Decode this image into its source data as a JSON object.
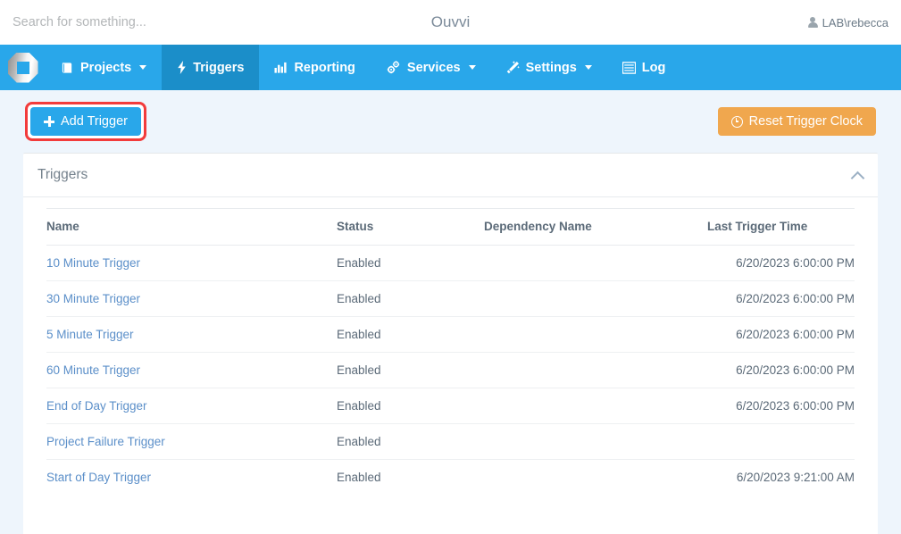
{
  "topbar": {
    "search_placeholder": "Search for something...",
    "search_value": "",
    "app_title": "Ouvvi",
    "user_name": "LAB\\rebecca",
    "user_icon": "user-icon"
  },
  "nav": {
    "brand_icon": "ouvvi-logo-icon",
    "items": [
      {
        "label": "Projects",
        "icon": "book-icon",
        "caret": true,
        "active": false
      },
      {
        "label": "Triggers",
        "icon": "bolt-icon",
        "caret": false,
        "active": true
      },
      {
        "label": "Reporting",
        "icon": "bar-chart-icon",
        "caret": false,
        "active": false
      },
      {
        "label": "Services",
        "icon": "cogs-icon",
        "caret": true,
        "active": false
      },
      {
        "label": "Settings",
        "icon": "magic-wand-icon",
        "caret": true,
        "active": false
      },
      {
        "label": "Log",
        "icon": "list-icon",
        "caret": false,
        "active": false
      }
    ]
  },
  "actions": {
    "add_trigger_label": "Add Trigger",
    "add_trigger_icon": "plus-icon",
    "add_trigger_highlighted": true,
    "reset_clock_label": "Reset Trigger Clock",
    "reset_clock_icon": "clock-icon"
  },
  "panel": {
    "title": "Triggers",
    "collapse_icon": "chevron-up-icon",
    "table": {
      "columns": [
        "Name",
        "Status",
        "Dependency Name",
        "Last Trigger Time"
      ],
      "rows": [
        {
          "name": "10 Minute Trigger",
          "status": "Enabled",
          "dependency": "",
          "last_trigger_time": "6/20/2023 6:00:00 PM"
        },
        {
          "name": "30 Minute Trigger",
          "status": "Enabled",
          "dependency": "",
          "last_trigger_time": "6/20/2023 6:00:00 PM"
        },
        {
          "name": "5 Minute Trigger",
          "status": "Enabled",
          "dependency": "",
          "last_trigger_time": "6/20/2023 6:00:00 PM"
        },
        {
          "name": "60 Minute Trigger",
          "status": "Enabled",
          "dependency": "",
          "last_trigger_time": "6/20/2023 6:00:00 PM"
        },
        {
          "name": "End of Day Trigger",
          "status": "Enabled",
          "dependency": "",
          "last_trigger_time": "6/20/2023 6:00:00 PM"
        },
        {
          "name": "Project Failure Trigger",
          "status": "Enabled",
          "dependency": "",
          "last_trigger_time": ""
        },
        {
          "name": "Start of Day Trigger",
          "status": "Enabled",
          "dependency": "",
          "last_trigger_time": "6/20/2023 9:21:00 AM"
        }
      ]
    }
  },
  "colors": {
    "nav_blue": "#29a7ea",
    "nav_active_blue": "#1b8ec9",
    "page_background": "#eef5fc",
    "primary_button": "#29a7ea",
    "warning_button": "#f0a74e",
    "highlight_ring": "#f23b3b",
    "link_blue": "#5b8fc9",
    "text_gray": "#5b6a78"
  }
}
